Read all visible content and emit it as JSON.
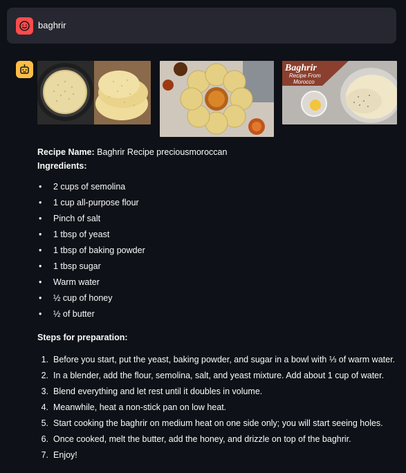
{
  "user_message": {
    "text": "baghrir"
  },
  "assistant": {
    "images": [
      {
        "name": "baghrir-pan-photo"
      },
      {
        "name": "baghrir-platter-photo"
      },
      {
        "name": "baghrir-recipe-thumbnail",
        "title": "Baghrir",
        "subtitle_line1": "Recipe From",
        "subtitle_line2": "Morocco"
      }
    ],
    "recipe_name_label": "Recipe Name:",
    "recipe_name_value": " Baghrir Recipe preciousmoroccan",
    "ingredients_label": "Ingredients:",
    "ingredients": [
      "2 cups of semolina",
      "1 cup all-purpose flour",
      "Pinch of salt",
      "1 tbsp of yeast",
      "1 tbsp of baking powder",
      "1 tbsp sugar",
      "Warm water",
      "½ cup of honey",
      "½ of butter"
    ],
    "steps_label": "Steps for preparation:",
    "steps": [
      {
        "num": "1.",
        "text": "Before you start, put the yeast, baking powder, and sugar in a bowl with ⅓ of warm water."
      },
      {
        "num": "2.",
        "text": "In a blender, add the flour, semolina, salt, and yeast mixture. Add about 1 cup of water."
      },
      {
        "num": "3.",
        "text": "Blend everything and let rest until it doubles in volume."
      },
      {
        "num": "4.",
        "text": "Meanwhile, heat a non-stick pan on low heat."
      },
      {
        "num": "5.",
        "text": "Start cooking the baghrir on medium heat on one side only; you will start seeing holes."
      },
      {
        "num": "6.",
        "text": "Once cooked, melt the butter, add the honey, and drizzle on top of the baghrir."
      },
      {
        "num": "7.",
        "text": "Enjoy!"
      }
    ]
  },
  "colors": {
    "background": "#0e1117",
    "user_bubble": "#262730",
    "user_avatar": "#ff4b4b",
    "bot_avatar": "#ffbd45"
  },
  "icons": {
    "user_avatar": "smiley-face-icon",
    "bot_avatar": "robot-face-icon"
  }
}
